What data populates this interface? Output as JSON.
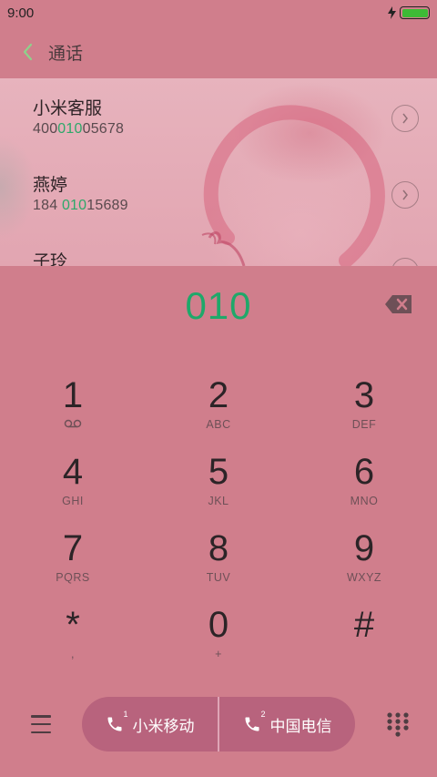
{
  "status_bar": {
    "time": "9:00",
    "charging_icon": "lightning-icon",
    "battery_color": "#3dbb36"
  },
  "header": {
    "title": "通话",
    "back_icon": "chevron-left-icon",
    "accent": "#8fd18b"
  },
  "results": [
    {
      "name": "小米客服",
      "number_pre": "400",
      "number_match": "010",
      "number_post": "05678"
    },
    {
      "name": "燕婷",
      "number_pre": "184 ",
      "number_match": "010",
      "number_post": "15689"
    },
    {
      "name": "子玲",
      "number_pre": "",
      "number_match": "",
      "number_post": ""
    }
  ],
  "dial": {
    "input": "010",
    "input_color": "#1fa86a",
    "delete_icon": "backspace-icon"
  },
  "keypad": [
    {
      "digit": "1",
      "sub": ""
    },
    {
      "digit": "2",
      "sub": "ABC"
    },
    {
      "digit": "3",
      "sub": "DEF"
    },
    {
      "digit": "4",
      "sub": "GHI"
    },
    {
      "digit": "5",
      "sub": "JKL"
    },
    {
      "digit": "6",
      "sub": "MNO"
    },
    {
      "digit": "7",
      "sub": "PQRS"
    },
    {
      "digit": "8",
      "sub": "TUV"
    },
    {
      "digit": "9",
      "sub": "WXYZ"
    },
    {
      "digit": "*",
      "sub": ","
    },
    {
      "digit": "0",
      "sub": "+"
    },
    {
      "digit": "#",
      "sub": ""
    }
  ],
  "bottom": {
    "menu_icon": "hamburger-menu-icon",
    "sim1": {
      "label": "小米移动",
      "sim_number": "1"
    },
    "sim2": {
      "label": "中国电信",
      "sim_number": "2"
    },
    "dialpad_icon": "dialpad-icon",
    "pill_color": "#b8637d"
  },
  "colors": {
    "background": "#d07e8c",
    "match_highlight": "#2ea86a"
  }
}
